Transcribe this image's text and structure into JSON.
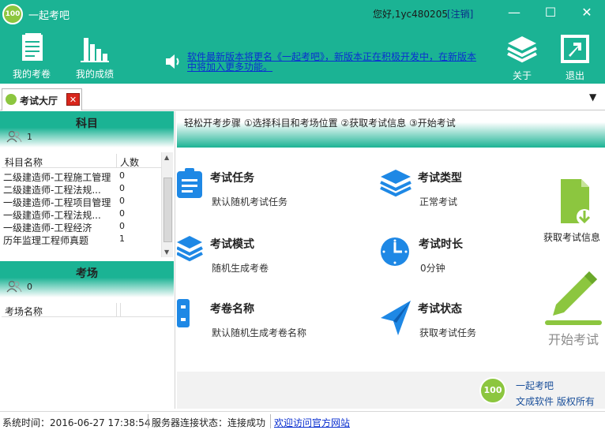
{
  "app": {
    "title": "一起考吧",
    "logo_text": "100",
    "greeting": "您好,1yc480205",
    "logout_label": "[注销]"
  },
  "window_controls": [
    "—",
    "☐",
    "✕"
  ],
  "toolbar": {
    "my_papers": "我的考卷",
    "my_scores": "我的成绩",
    "notice": "软件最新版本将更名《一起考吧》，新版本正在积极开发中，在新版本中将加入更多功能。",
    "about": "关于",
    "exit": "退出"
  },
  "tab": {
    "label": "考试大厅",
    "close": "✕"
  },
  "subjects": {
    "title": "科目",
    "count": "1",
    "col_name": "科目名称",
    "col_count": "人数",
    "rows": [
      {
        "name": "二级建造师-工程施工管理",
        "count": "0"
      },
      {
        "name": "二级建造师-工程法规...",
        "count": "0"
      },
      {
        "name": "一级建造师-工程项目管理",
        "count": "0"
      },
      {
        "name": "一级建造师-工程法规...",
        "count": "0"
      },
      {
        "name": "一级建造师-工程经济",
        "count": "0"
      },
      {
        "name": "历年监理工程师真题",
        "count": "1"
      }
    ]
  },
  "venues": {
    "title": "考场",
    "count": "0",
    "col_name": "考场名称"
  },
  "steps": "轻松开考步骤 ①选择科目和考场位置 ②获取考试信息 ③开始考试",
  "cards": {
    "task": {
      "title": "考试任务",
      "value": "默认随机考试任务"
    },
    "type": {
      "title": "考试类型",
      "value": "正常考试"
    },
    "mode": {
      "title": "考试模式",
      "value": "随机生成考卷"
    },
    "duration": {
      "title": "考试时长",
      "value": "0分钟"
    },
    "paper": {
      "title": "考卷名称",
      "value": "默认随机生成考卷名称"
    },
    "status": {
      "title": "考试状态",
      "value": "获取考试任务"
    }
  },
  "actions": {
    "get_info": "获取考试信息",
    "start": "开始考试"
  },
  "brand": {
    "logo_text": "100",
    "name": "一起考吧",
    "rights": "文成软件  版权所有"
  },
  "statusbar": {
    "time": "系统时间：2016-06-27 17:38:54",
    "server": "服务器连接状态：连接成功",
    "link": "欢迎访问官方网站"
  },
  "colors": {
    "brand_green": "#1bb394",
    "icon_blue": "#1e88e5",
    "action_green": "#8cc63f",
    "close_red": "#d9261c"
  }
}
